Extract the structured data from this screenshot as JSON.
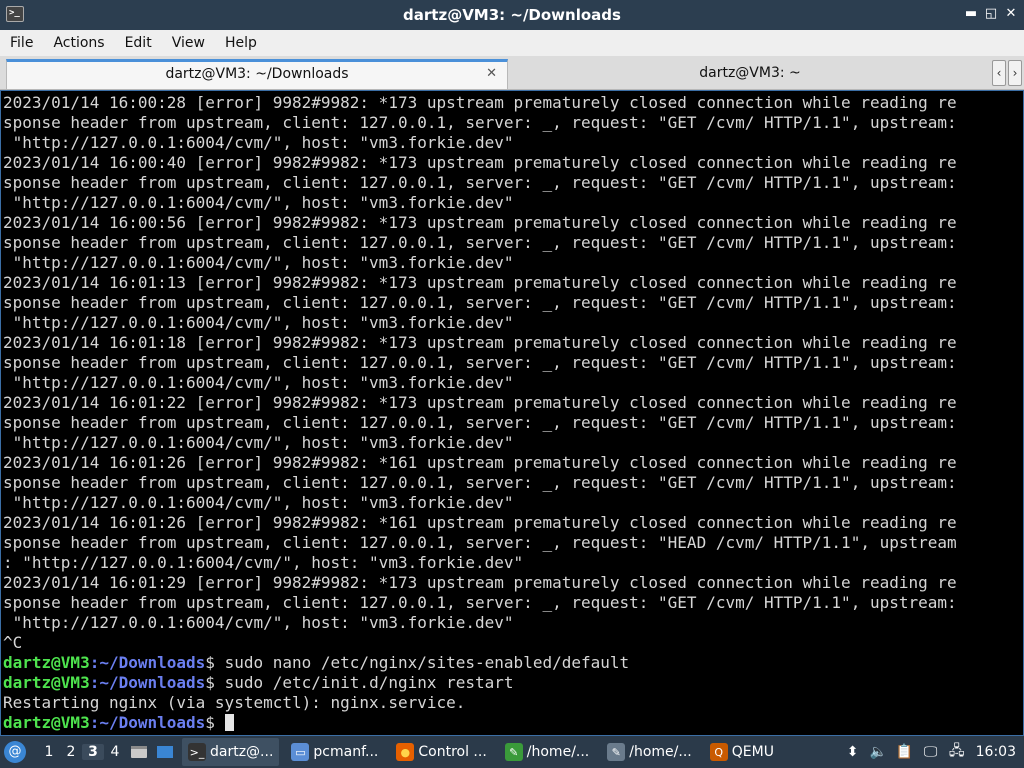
{
  "window": {
    "title": "dartz@VM3: ~/Downloads",
    "minimize_glyph": "▬",
    "maximize_glyph": "◱",
    "close_glyph": "✕"
  },
  "menu": [
    "File",
    "Actions",
    "Edit",
    "View",
    "Help"
  ],
  "tabs": [
    {
      "label": "dartz@VM3: ~/Downloads",
      "active": true
    },
    {
      "label": "dartz@VM3: ~",
      "active": false
    }
  ],
  "tab_scroll": {
    "left": "‹",
    "right": "›"
  },
  "terminal": {
    "lines": [
      "2023/01/14 16:00:28 [error] 9982#9982: *173 upstream prematurely closed connection while reading re",
      "sponse header from upstream, client: 127.0.0.1, server: _, request: \"GET /cvm/ HTTP/1.1\", upstream:",
      " \"http://127.0.0.1:6004/cvm/\", host: \"vm3.forkie.dev\"",
      "2023/01/14 16:00:40 [error] 9982#9982: *173 upstream prematurely closed connection while reading re",
      "sponse header from upstream, client: 127.0.0.1, server: _, request: \"GET /cvm/ HTTP/1.1\", upstream:",
      " \"http://127.0.0.1:6004/cvm/\", host: \"vm3.forkie.dev\"",
      "2023/01/14 16:00:56 [error] 9982#9982: *173 upstream prematurely closed connection while reading re",
      "sponse header from upstream, client: 127.0.0.1, server: _, request: \"GET /cvm/ HTTP/1.1\", upstream:",
      " \"http://127.0.0.1:6004/cvm/\", host: \"vm3.forkie.dev\"",
      "2023/01/14 16:01:13 [error] 9982#9982: *173 upstream prematurely closed connection while reading re",
      "sponse header from upstream, client: 127.0.0.1, server: _, request: \"GET /cvm/ HTTP/1.1\", upstream:",
      " \"http://127.0.0.1:6004/cvm/\", host: \"vm3.forkie.dev\"",
      "2023/01/14 16:01:18 [error] 9982#9982: *173 upstream prematurely closed connection while reading re",
      "sponse header from upstream, client: 127.0.0.1, server: _, request: \"GET /cvm/ HTTP/1.1\", upstream:",
      " \"http://127.0.0.1:6004/cvm/\", host: \"vm3.forkie.dev\"",
      "2023/01/14 16:01:22 [error] 9982#9982: *173 upstream prematurely closed connection while reading re",
      "sponse header from upstream, client: 127.0.0.1, server: _, request: \"GET /cvm/ HTTP/1.1\", upstream:",
      " \"http://127.0.0.1:6004/cvm/\", host: \"vm3.forkie.dev\"",
      "2023/01/14 16:01:26 [error] 9982#9982: *161 upstream prematurely closed connection while reading re",
      "sponse header from upstream, client: 127.0.0.1, server: _, request: \"GET /cvm/ HTTP/1.1\", upstream:",
      " \"http://127.0.0.1:6004/cvm/\", host: \"vm3.forkie.dev\"",
      "2023/01/14 16:01:26 [error] 9982#9982: *161 upstream prematurely closed connection while reading re",
      "sponse header from upstream, client: 127.0.0.1, server: _, request: \"HEAD /cvm/ HTTP/1.1\", upstream",
      ": \"http://127.0.0.1:6004/cvm/\", host: \"vm3.forkie.dev\"",
      "2023/01/14 16:01:29 [error] 9982#9982: *173 upstream prematurely closed connection while reading re",
      "sponse header from upstream, client: 127.0.0.1, server: _, request: \"GET /cvm/ HTTP/1.1\", upstream:",
      " \"http://127.0.0.1:6004/cvm/\", host: \"vm3.forkie.dev\"",
      "^C"
    ],
    "prompt_user": "dartz@VM3",
    "prompt_path": ":~/Downloads",
    "prompt_symbol": "$",
    "commands": [
      {
        "cmd": " sudo nano /etc/nginx/sites-enabled/default",
        "output": []
      },
      {
        "cmd": " sudo /etc/init.d/nginx restart",
        "output": [
          "Restarting nginx (via systemctl): nginx.service."
        ]
      },
      {
        "cmd": " ",
        "output": []
      }
    ],
    "colors": {
      "background": "#000000",
      "text": "#d6d6d6",
      "prompt_user": "#4ee44e",
      "prompt_path": "#6b7ff0"
    }
  },
  "taskbar": {
    "start_icon": "debian-swirl-icon",
    "workspaces": [
      "1",
      "2",
      "3",
      "4"
    ],
    "active_workspace": "3",
    "tasks": [
      {
        "label": "dartz@...",
        "icon": "terminal-icon",
        "active": true
      },
      {
        "label": "pcmanf...",
        "icon": "folder-icon",
        "active": false
      },
      {
        "label": "Control ...",
        "icon": "firefox-icon",
        "active": false
      },
      {
        "label": "/home/...",
        "icon": "text-editor-icon",
        "active": false
      },
      {
        "label": "/home/...",
        "icon": "document-icon",
        "active": false
      },
      {
        "label": "QEMU",
        "icon": "qemu-icon",
        "active": false
      }
    ],
    "clock": "16:03"
  }
}
